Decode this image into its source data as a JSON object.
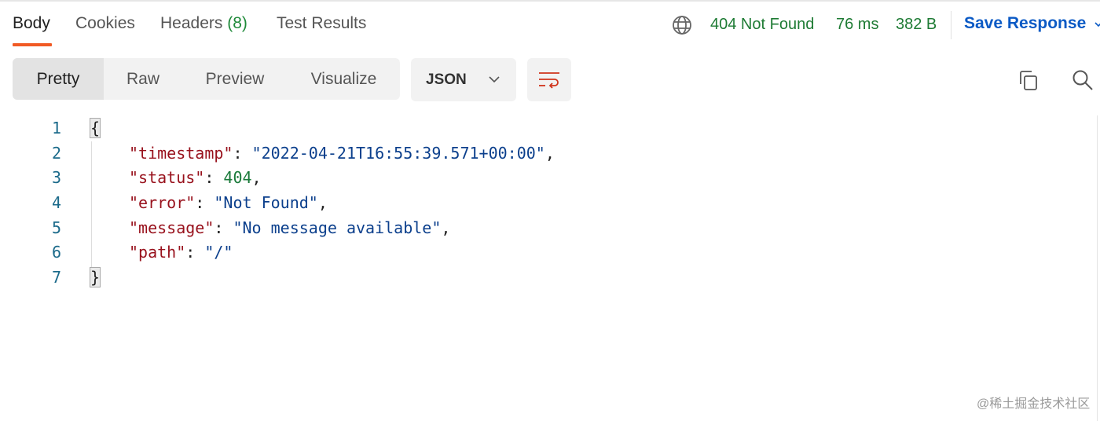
{
  "tabs": [
    {
      "label": "Body"
    },
    {
      "label": "Cookies"
    },
    {
      "label": "Headers",
      "count": "(8)"
    },
    {
      "label": "Test Results"
    }
  ],
  "status": {
    "code": "404 Not Found",
    "time": "76 ms",
    "size": "382 B"
  },
  "save_label": "Save Response",
  "view_modes": [
    "Pretty",
    "Raw",
    "Preview",
    "Visualize"
  ],
  "format": "JSON",
  "colors": {
    "accent": "#f15a24",
    "status": "#1e7b34",
    "save": "#0b5ac5"
  },
  "code": {
    "line_numbers": [
      "1",
      "2",
      "3",
      "4",
      "5",
      "6",
      "7"
    ],
    "open": "{",
    "close": "}",
    "fields": [
      {
        "key": "\"timestamp\"",
        "value": "\"2022-04-21T16:55:39.571+00:00\"",
        "type": "string",
        "comma": ","
      },
      {
        "key": "\"status\"",
        "value": "404",
        "type": "number",
        "comma": ","
      },
      {
        "key": "\"error\"",
        "value": "\"Not Found\"",
        "type": "string",
        "comma": ","
      },
      {
        "key": "\"message\"",
        "value": "\"No message available\"",
        "type": "string",
        "comma": ","
      },
      {
        "key": "\"path\"",
        "value": "\"/\"",
        "type": "string",
        "comma": ""
      }
    ]
  },
  "watermark": "@稀土掘金技术社区"
}
